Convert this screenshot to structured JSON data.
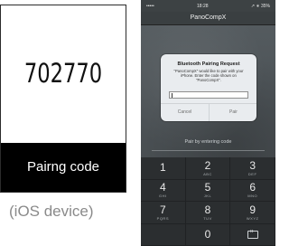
{
  "code_card": {
    "code": "702770",
    "footer": "Pairng code",
    "caption": "(iOS device)"
  },
  "phone": {
    "status": {
      "left": "•••••",
      "time": "18:28",
      "right": "↗ ∗ 35%"
    },
    "nav_title": "PanoCompX",
    "alert": {
      "title": "Bluetooth Pairing Request",
      "message": "\"PanoCompX\" would like to pair with your iPhone. Enter the code shown on \"PanoCompX\".",
      "input_value": "",
      "cancel": "Cancel",
      "pair": "Pair"
    },
    "prompt": "Pair by entering code",
    "keypad": [
      {
        "num": "1",
        "sub": ""
      },
      {
        "num": "2",
        "sub": "ABC"
      },
      {
        "num": "3",
        "sub": "DEF"
      },
      {
        "num": "4",
        "sub": "GHI"
      },
      {
        "num": "5",
        "sub": "JKL"
      },
      {
        "num": "6",
        "sub": "MNO"
      },
      {
        "num": "7",
        "sub": "PQRS"
      },
      {
        "num": "8",
        "sub": "TUV"
      },
      {
        "num": "9",
        "sub": "WXYZ"
      },
      {
        "num": "",
        "sub": ""
      },
      {
        "num": "0",
        "sub": ""
      },
      {
        "num": "",
        "sub": ""
      }
    ]
  }
}
